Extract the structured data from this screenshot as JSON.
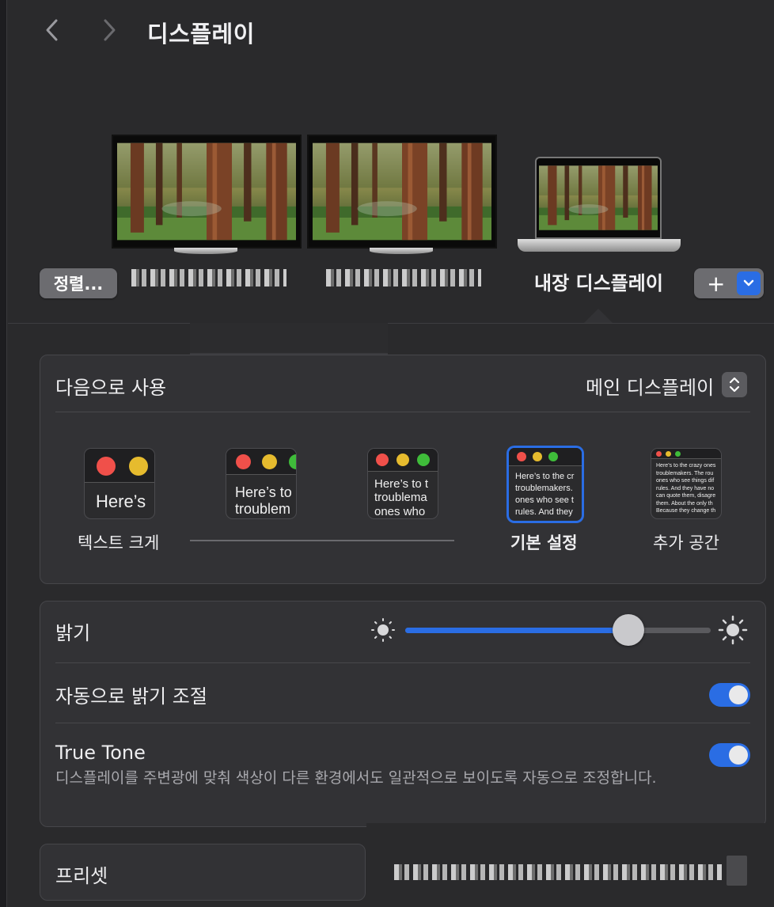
{
  "header": {
    "title": "디스플레이"
  },
  "displays": {
    "arrange_label": "정렬...",
    "builtin_label": "내장 디스플레이",
    "add_label": "+"
  },
  "use_as": {
    "label": "다음으로 사용",
    "value": "메인 디스플레이"
  },
  "text_size": {
    "options": [
      {
        "caption": "텍스트 크게",
        "text": "Here’s"
      },
      {
        "caption": "",
        "text": "Here’s to\ntroublem"
      },
      {
        "caption": "",
        "text": "Here’s to t\ntroublema\nones who"
      },
      {
        "caption": "기본 설정",
        "text": "Here’s to the cr\ntroublemakers.\nones who see t\nrules. And they"
      },
      {
        "caption": "추가 공간",
        "text": "Here’s to the crazy ones\ntroublemakers. The rou\nones who see things dif\nrules. And they have no\ncan quote them, disagre\nthem. About the only th\nBecause they change th"
      }
    ],
    "selected_index": 3
  },
  "brightness": {
    "label": "밝기",
    "value": 0.73
  },
  "auto_brightness": {
    "label": "자동으로 밝기 조절",
    "on": true
  },
  "true_tone": {
    "label": "True Tone",
    "description": "디스플레이를 주변광에 맞춰 색상이 다른 환경에서도 일관적으로 보이도록 자동으로 조정합니다.",
    "on": true
  },
  "preset": {
    "label": "프리셋"
  },
  "colors": {
    "accent": "#2a6de4",
    "card": "#323235",
    "background": "#2a2a2c"
  }
}
